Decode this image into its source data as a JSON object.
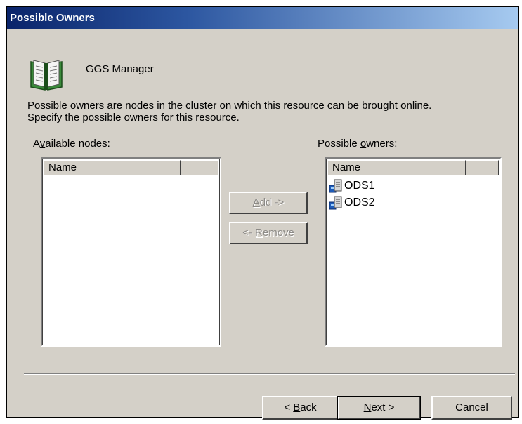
{
  "window": {
    "title": "Possible Owners"
  },
  "header": {
    "icon": "book-icon",
    "resource_name": "GGS Manager"
  },
  "description": {
    "line1": "Possible owners are nodes in the cluster on which this resource can be brought online.",
    "line2": "Specify the possible owners for this resource."
  },
  "available_nodes": {
    "label_pre": "A",
    "label_accel": "v",
    "label_post": "ailable nodes:",
    "column_name": "Name",
    "items": []
  },
  "possible_owners": {
    "label_pre": "Possible ",
    "label_accel": "o",
    "label_post": "wners:",
    "column_name": "Name",
    "items": [
      {
        "label": "ODS1",
        "icon": "cluster-node-icon"
      },
      {
        "label": "ODS2",
        "icon": "cluster-node-icon"
      }
    ]
  },
  "buttons": {
    "add": {
      "pre": "",
      "accel": "A",
      "post": "dd ->"
    },
    "remove": {
      "pre": "<- ",
      "accel": "R",
      "post": "emove"
    },
    "back": {
      "pre": "< ",
      "accel": "B",
      "post": "ack"
    },
    "next": {
      "pre": "",
      "accel": "N",
      "post": "ext >"
    },
    "cancel": "Cancel"
  },
  "colors": {
    "dialog_bg": "#d4d0c8",
    "title_gradient_start": "#0a246a",
    "title_gradient_end": "#a6caf0",
    "disabled_text": "#8c8a86"
  }
}
